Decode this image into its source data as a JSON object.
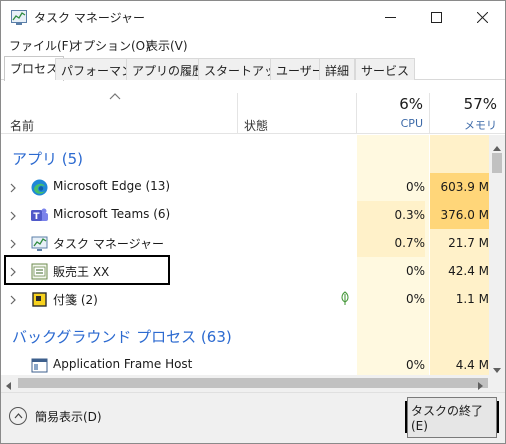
{
  "window": {
    "title": "タスク マネージャー"
  },
  "menu": [
    "ファイル(F)",
    "オプション(O)",
    "表示(V)"
  ],
  "tabs": [
    "プロセス",
    "パフォーマンス",
    "アプリの履歴",
    "スタートアップ",
    "ユーザー",
    "詳細",
    "サービス"
  ],
  "active_tab": "プロセス",
  "columns": {
    "name": "名前",
    "status": "状態",
    "cpu_total": "6%",
    "cpu_label": "CPU",
    "mem_total": "57%",
    "mem_label": "メモリ"
  },
  "groups": {
    "apps": "アプリ (5)",
    "background": "バックグラウンド プロセス (63)"
  },
  "rows": [
    {
      "name": "Microsoft Edge (13)",
      "icon": "edge-icon",
      "cpu": "0%",
      "mem": "603.9 M"
    },
    {
      "name": "Microsoft Teams (6)",
      "icon": "teams-icon",
      "cpu": "0.3%",
      "mem": "376.0 M"
    },
    {
      "name": "タスク マネージャー",
      "icon": "task-manager-icon",
      "cpu": "0.7%",
      "mem": "21.7 M"
    },
    {
      "name": "販売王 XX",
      "icon": "hanbaio-icon",
      "cpu": "0%",
      "mem": "42.4 M"
    },
    {
      "name": "付箋 (2)",
      "icon": "sticky-notes-icon",
      "cpu": "0%",
      "mem": "1.1 M"
    }
  ],
  "bg_rows": [
    {
      "name": "Application Frame Host",
      "icon": "app-frame-icon",
      "cpu": "0%",
      "mem": "4.4 M"
    }
  ],
  "footer": {
    "less": "簡易表示(D)",
    "end_task": "タスクの終了(E)"
  },
  "colors": {
    "accent": "#2c6ad0",
    "cpu_column": "#fff9e0",
    "mem_column": "#fff1c9",
    "mem_high": "#ffd679"
  }
}
